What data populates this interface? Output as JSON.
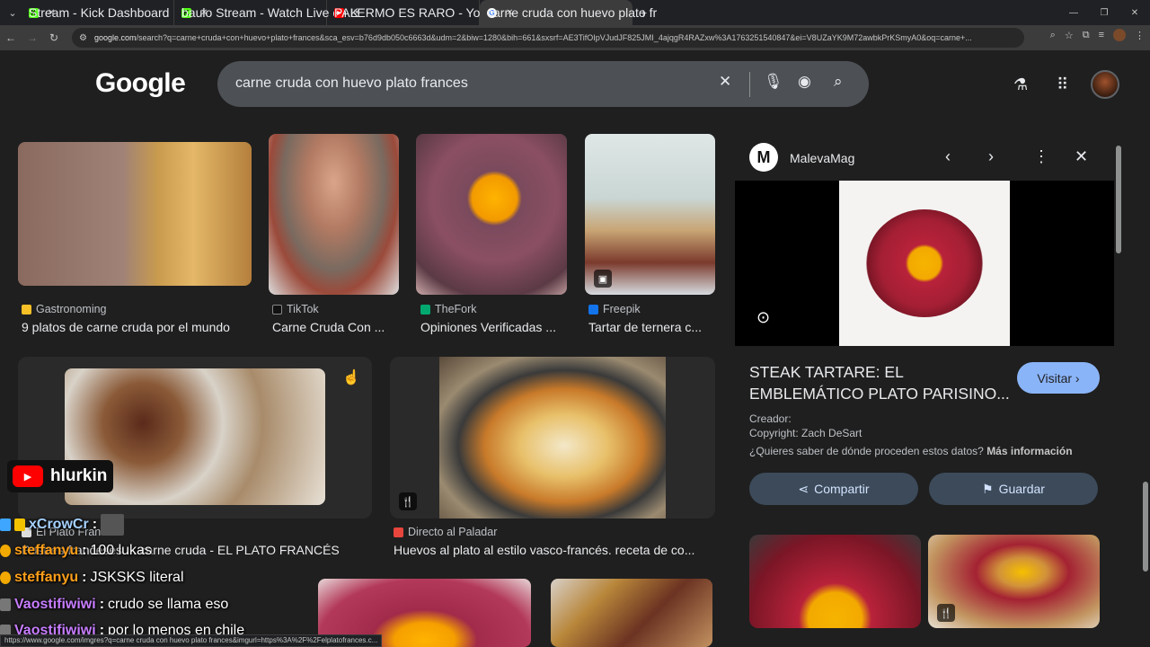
{
  "browser": {
    "tabs": [
      {
        "title": "Stream - Kick Dashboard",
        "fav_color": "#53fc18",
        "fav_text": "K"
      },
      {
        "title": "baulo Stream - Watch Live on K",
        "fav_color": "#53fc18",
        "fav_text": "K"
      },
      {
        "title": "PALERMO ES RARO - YouTube",
        "fav_color": "#ff0000",
        "fav_text": "▶"
      },
      {
        "title": "carne cruda con huevo plato fr",
        "fav_color": "#ffffff",
        "fav_text": "G"
      }
    ],
    "url_domain": "google.com",
    "url_rest": "/search?q=carne+cruda+con+huevo+plato+frances&sca_esv=b76d9db050c6663d&udm=2&biw=1280&bih=661&sxsrf=AE3TifOIpVJudJF825JMI_4ajqgR4RAZxw%3A1763251540847&ei=V8UZaYK9M72awbkPrKSmyA0&oq=carne+..."
  },
  "google": {
    "logo": "Google",
    "query": "carne cruda con huevo plato frances"
  },
  "results": [
    {
      "source": "Gastronoming",
      "title": "9 platos de carne cruda por el mundo",
      "fav_color": "#f6c026"
    },
    {
      "source": "TikTok",
      "title": "Carne Cruda Con ...",
      "fav_color": "#111111"
    },
    {
      "source": "TheFork",
      "title": "Opiniones Verificadas ...",
      "fav_color": "#00a870"
    },
    {
      "source": "Freepik",
      "title": "Tartar de ternera c...",
      "fav_color": "#1273eb"
    },
    {
      "source": "El Plato Francés",
      "title": "Postres franceses ... carne cruda - EL PLATO FRANCÉS",
      "fav_color": "#dddddd"
    },
    {
      "source": "Directo al Paladar",
      "title": "Huevos al plato al estilo vasco-francés. receta de co...",
      "fav_color": "#e8453c"
    }
  ],
  "panel": {
    "site": "MalevaMag",
    "logo_letter": "M",
    "title": "STEAK TARTARE: EL EMBLEMÁTICO PLATO PARISINO...",
    "visit_label": "Visitar ›",
    "creator_label": "Creador:",
    "copyright": "Copyright: Zach DeSart",
    "question": "¿Quieres saber de dónde proceden estos datos?",
    "more_info": "Más información",
    "share_label": "Compartir",
    "save_label": "Guardar"
  },
  "overlay": {
    "yt_name": "hlurkin",
    "chat": [
      {
        "user": "xCrowCr",
        "msg": "",
        "color": "#a6d1ff"
      },
      {
        "user": "steffanyu",
        "msg": "100 lukas",
        "color": "#ff9f1a"
      },
      {
        "user": "steffanyu",
        "msg": "JSKSKS literal",
        "color": "#ff9f1a"
      },
      {
        "user": "Vaostifiwiwi",
        "msg": "crudo se llama eso",
        "color": "#c77dff"
      },
      {
        "user": "Vaostifiwiwi",
        "msg": "por lo menos en chile",
        "color": "#c77dff"
      }
    ]
  },
  "status_url": "https://www.google.com/imgres?q=carne cruda con huevo plato frances&imgurl=https%3A%2F%2Felplatofrances.c..."
}
